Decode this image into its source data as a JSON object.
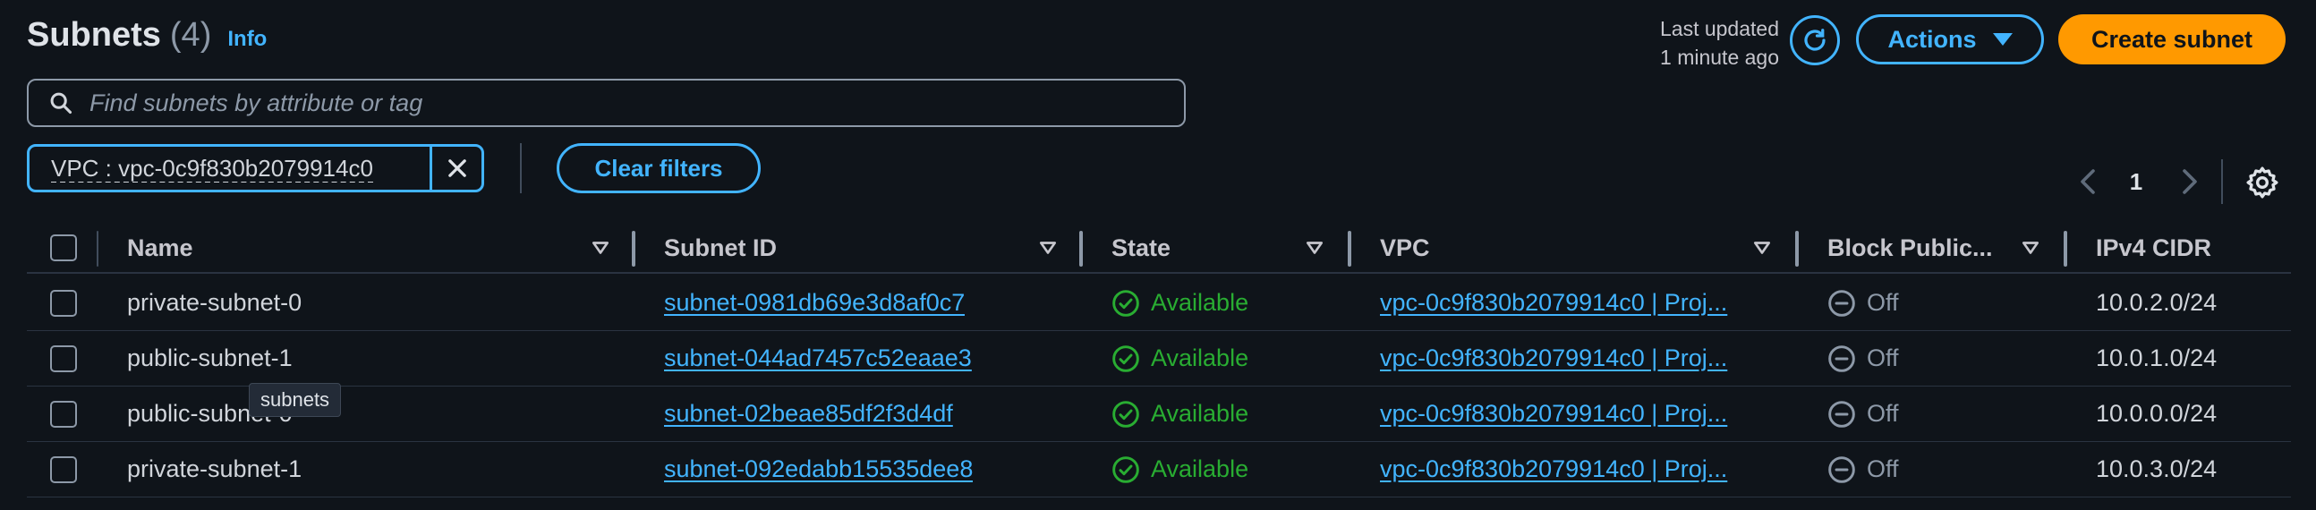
{
  "header": {
    "title": "Subnets",
    "count": "(4)",
    "info": "Info",
    "last_updated_line1": "Last updated",
    "last_updated_line2": "1 minute ago",
    "actions_label": "Actions",
    "create_label": "Create subnet"
  },
  "search": {
    "placeholder": "Find subnets by attribute or tag",
    "value": ""
  },
  "filter": {
    "chip_label": "VPC : vpc-0c9f830b2079914c0",
    "clear_label": "Clear filters"
  },
  "pagination": {
    "page": "1"
  },
  "table": {
    "columns": [
      "Name",
      "Subnet ID",
      "State",
      "VPC",
      "Block Public...",
      "IPv4 CIDR"
    ],
    "rows": [
      {
        "name": "private-subnet-0",
        "subnet_id": "subnet-0981db69e3d8af0c7",
        "state": "Available",
        "vpc": "vpc-0c9f830b2079914c0 | Proj...",
        "block_public": "Off",
        "cidr": "10.0.2.0/24"
      },
      {
        "name": "public-subnet-1",
        "subnet_id": "subnet-044ad7457c52eaae3",
        "state": "Available",
        "vpc": "vpc-0c9f830b2079914c0 | Proj...",
        "block_public": "Off",
        "cidr": "10.0.1.0/24"
      },
      {
        "name": "public-subnet-0",
        "subnet_id": "subnet-02beae85df2f3d4df",
        "state": "Available",
        "vpc": "vpc-0c9f830b2079914c0 | Proj...",
        "block_public": "Off",
        "cidr": "10.0.0.0/24"
      },
      {
        "name": "private-subnet-1",
        "subnet_id": "subnet-092edabb15535dee8",
        "state": "Available",
        "vpc": "vpc-0c9f830b2079914c0 | Proj...",
        "block_public": "Off",
        "cidr": "10.0.3.0/24"
      }
    ]
  },
  "tooltip": {
    "text": "subnets"
  },
  "colors": {
    "background": "#0f141a",
    "accent": "#42b4ff",
    "primary_button": "#ff9900",
    "available": "#29ad32",
    "muted": "#8d99a8"
  },
  "icons": {
    "search": "search-icon",
    "refresh": "refresh-icon",
    "dropdown": "caret-down-icon",
    "close": "close-icon",
    "sort": "sort-icon",
    "status_available": "check-circle-icon",
    "status_off": "minus-circle-icon",
    "settings": "gear-icon",
    "prev": "chevron-left-icon",
    "next": "chevron-right-icon"
  }
}
